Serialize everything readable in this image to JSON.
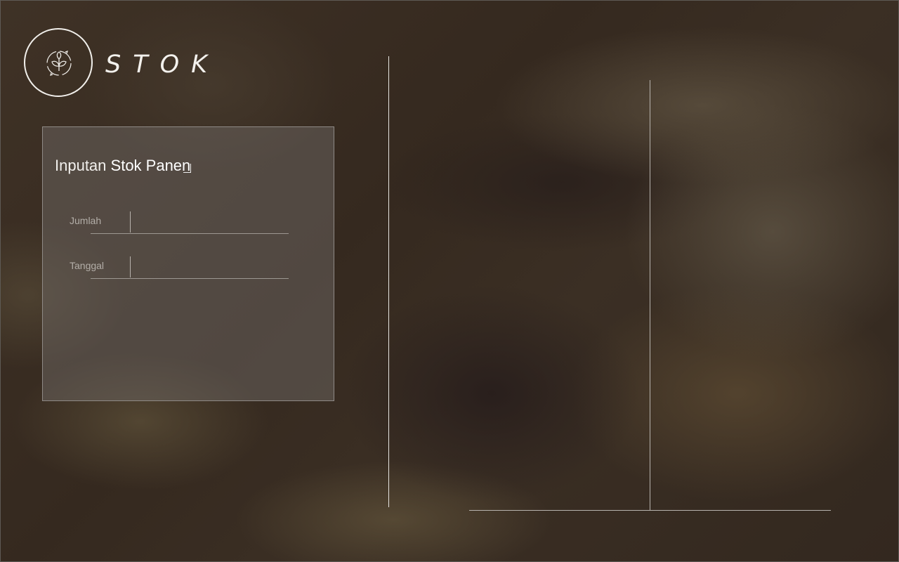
{
  "app": {
    "brand_name": "STOK",
    "logo_icon": "leaf-recycle-icon"
  },
  "form": {
    "title_light": "Inputan",
    "title_bold": "Stok Panen",
    "fields": [
      {
        "label": "Jumlah",
        "value": ""
      },
      {
        "label": "Tanggal",
        "value": ""
      }
    ]
  },
  "colors": {
    "panel_background": "#6e6864",
    "accent_line": "#e8e6e2",
    "label_text": "#b3aea8"
  }
}
